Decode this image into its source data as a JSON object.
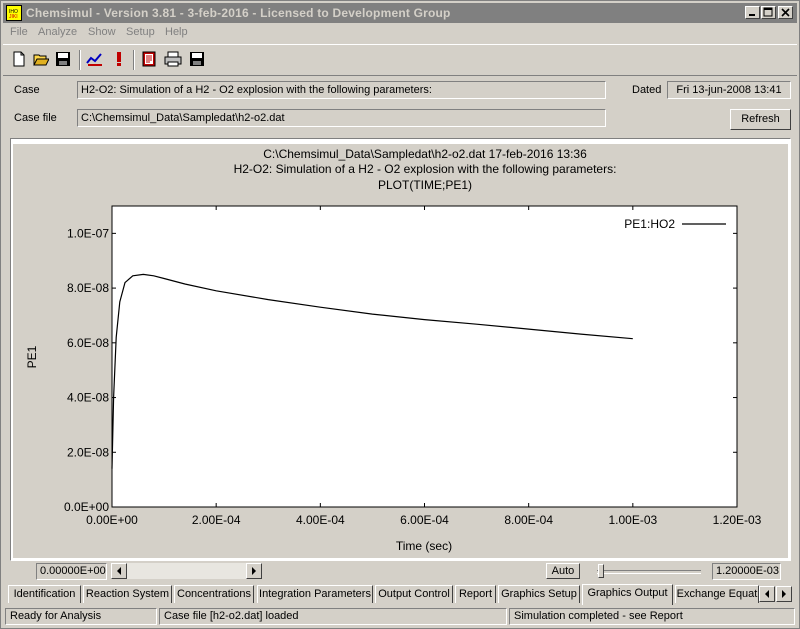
{
  "window": {
    "title": "Chemsimul - Version 3.81 - 3-feb-2016 - Licensed to Development Group",
    "app_icon_text": "IHO\nJIKI"
  },
  "menu": [
    "File",
    "Analyze",
    "Show",
    "Setup",
    "Help"
  ],
  "toolbar": {
    "icons": [
      "new-file-icon",
      "open-folder-icon",
      "save-icon",
      "chart-check-icon",
      "alert-icon",
      "report-icon",
      "print-icon",
      "save-output-icon"
    ]
  },
  "case": {
    "label": "Case",
    "value": "H2-O2: Simulation of a H2 - O2 explosion with the following parameters:",
    "dated_label": "Dated",
    "dated_value": "Fri 13-jun-2008 13:41",
    "file_label": "Case file",
    "file_value": "C:\\Chemsimul_Data\\Sampledat\\h2-o2.dat",
    "refresh_label": "Refresh"
  },
  "graph": {
    "header_line1": "C:\\Chemsimul_Data\\Sampledat\\h2-o2.dat 17-feb-2016 13:36",
    "header_line2": "H2-O2: Simulation of a H2 - O2 explosion with the following parameters:",
    "header_line3": "PLOT(TIME;PE1)"
  },
  "chart_data": {
    "type": "line",
    "title": "PLOT(TIME;PE1)",
    "xlabel": "Time (sec)",
    "ylabel": "PE1",
    "xlim": [
      0,
      0.0012
    ],
    "ylim": [
      0,
      1.1e-07
    ],
    "xticks": [
      "0.00E+00",
      "2.00E-04",
      "4.00E-04",
      "6.00E-04",
      "8.00E-04",
      "1.00E-03",
      "1.20E-03"
    ],
    "xtick_values": [
      0,
      0.0002,
      0.0004,
      0.0006,
      0.0008,
      0.001,
      0.0012
    ],
    "yticks": [
      "0.0E+00",
      "2.0E-08",
      "4.0E-08",
      "6.0E-08",
      "8.0E-08",
      "1.0E-07"
    ],
    "ytick_values": [
      0,
      2e-08,
      4e-08,
      6e-08,
      8e-08,
      1e-07
    ],
    "legend_position": "top-right",
    "grid": false,
    "series": [
      {
        "name": "PE1:HO2",
        "color": "#000000",
        "x": [
          0,
          3e-06,
          8e-06,
          1.5e-05,
          2.5e-05,
          4e-05,
          6e-05,
          8e-05,
          0.0001,
          0.00014,
          0.0002,
          0.0003,
          0.0004,
          0.0005,
          0.0006,
          0.0007,
          0.0008,
          0.0009,
          0.001
        ],
        "y": [
          1.4e-08,
          4e-08,
          6.2e-08,
          7.5e-08,
          8.2e-08,
          8.45e-08,
          8.5e-08,
          8.45e-08,
          8.35e-08,
          8.15e-08,
          7.9e-08,
          7.58e-08,
          7.3e-08,
          7.05e-08,
          6.85e-08,
          6.68e-08,
          6.5e-08,
          6.32e-08,
          6.15e-08
        ]
      }
    ]
  },
  "controls": {
    "xmin_value": "0.00000E+00",
    "auto_label": "Auto",
    "xmax_value": "1.20000E-03"
  },
  "tabs": [
    {
      "label": "Identification",
      "active": false
    },
    {
      "label": "Reaction System",
      "active": false
    },
    {
      "label": "Concentrations",
      "active": false
    },
    {
      "label": "Integration Parameters",
      "active": false
    },
    {
      "label": "Output Control",
      "active": false
    },
    {
      "label": "Report",
      "active": false
    },
    {
      "label": "Graphics Setup",
      "active": false
    },
    {
      "label": "Graphics Output",
      "active": true
    },
    {
      "label": "Exchange Equat",
      "active": false
    }
  ],
  "status": {
    "left": "Ready for Analysis",
    "middle": "Case file [h2-o2.dat] loaded",
    "right": "Simulation completed - see Report"
  }
}
